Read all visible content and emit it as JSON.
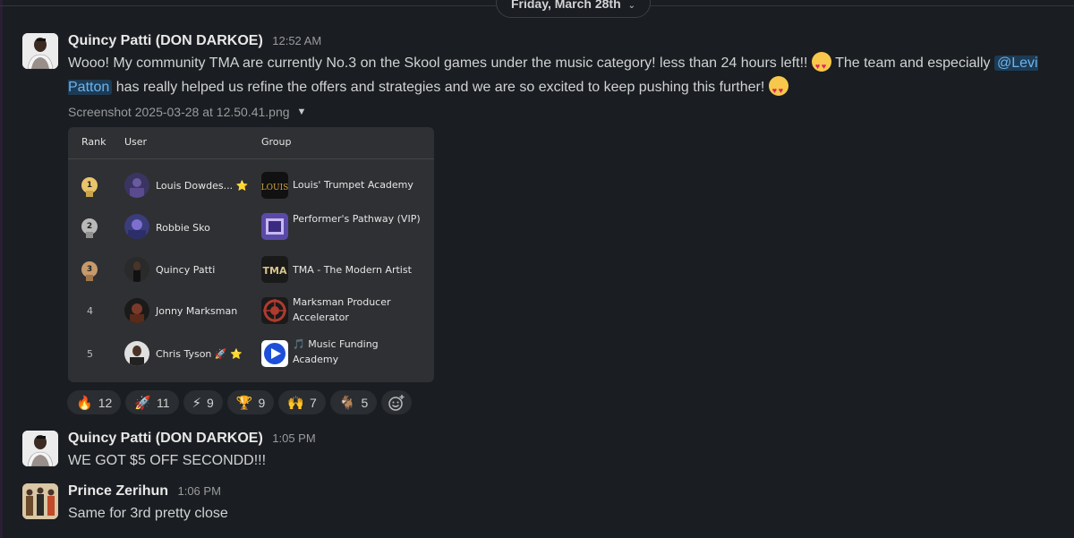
{
  "date_divider": {
    "label": "Friday, March 28th"
  },
  "messages": [
    {
      "author": "Quincy Patti (DON DARKOE)",
      "time": "12:52 AM",
      "text_part1": "Wooo! My community TMA are currently No.3 on the Skool games under the music category! less than 24 hours left!!",
      "text_part2": "The team and especially",
      "mention": "@Levi Patton",
      "text_part3": "has really helped us refine the offers and strategies and we are so excited to keep pushing this further!",
      "attachment": {
        "filename": "Screenshot 2025-03-28 at 12.50.41.png",
        "leaderboard": {
          "headers": {
            "rank": "Rank",
            "user": "User",
            "group": "Group"
          },
          "rows": [
            {
              "rank": "1",
              "medal_color": "#e9c46a",
              "user": "Louis Dowdes... ⭐",
              "group": "Louis' Trumpet Academy"
            },
            {
              "rank": "2",
              "medal_color": "#b9b9b9",
              "user": "Robbie Sko",
              "group": "Performer's Pathway (VIP)"
            },
            {
              "rank": "3",
              "medal_color": "#c79a6b",
              "user": "Quincy Patti",
              "group": "TMA - The Modern Artist"
            },
            {
              "rank": "4",
              "user": "Jonny Marksman",
              "group": "Marksman Producer Accelerator"
            },
            {
              "rank": "5",
              "user": "Chris Tyson 🚀 ⭐",
              "group": "🎵 Music Funding Academy"
            }
          ]
        }
      },
      "reactions": [
        {
          "emoji": "🔥",
          "count": "12"
        },
        {
          "emoji": "🚀",
          "count": "11"
        },
        {
          "emoji": "⚡",
          "count": "9"
        },
        {
          "emoji": "🏆",
          "count": "9"
        },
        {
          "emoji": "🙌",
          "count": "7"
        },
        {
          "emoji": "🐐",
          "count": "5"
        }
      ]
    },
    {
      "author": "Quincy Patti (DON DARKOE)",
      "time": "1:05 PM",
      "text": "WE GOT $5 OFF SECONDD!!!"
    },
    {
      "author": "Prince Zerihun",
      "time": "1:06 PM",
      "text": "Same for 3rd pretty close"
    }
  ],
  "colors": {
    "background": "#1a1d21",
    "mention_bg": "#1d3b54",
    "mention_text": "#6cb4ee",
    "reaction_bg": "#2a2d31"
  }
}
